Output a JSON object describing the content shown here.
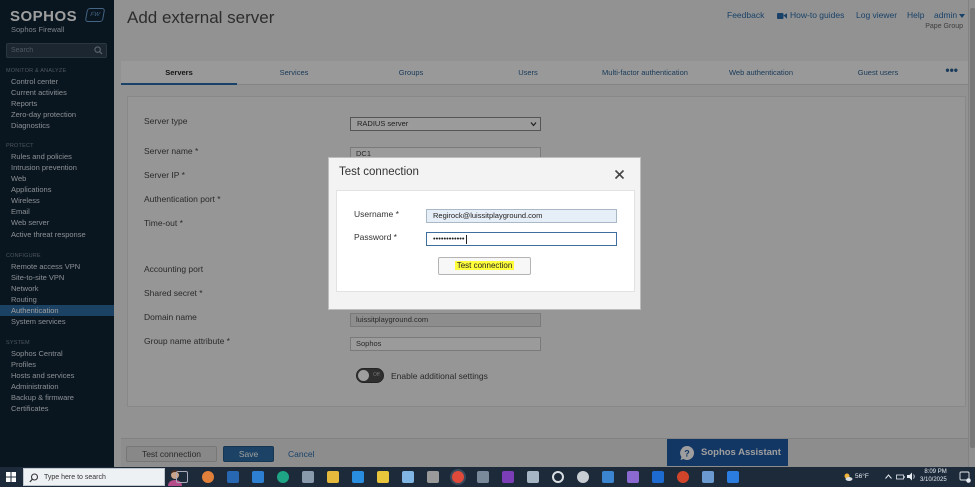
{
  "brand": {
    "logo": "SOPHOS",
    "badge": "FW",
    "product": "Sophos Firewall"
  },
  "sidebar": {
    "search_placeholder": "Search",
    "sections": [
      {
        "title": "MONITOR & ANALYZE",
        "items": [
          "Control center",
          "Current activities",
          "Reports",
          "Zero-day protection",
          "Diagnostics"
        ]
      },
      {
        "title": "PROTECT",
        "items": [
          "Rules and policies",
          "Intrusion prevention",
          "Web",
          "Applications",
          "Wireless",
          "Email",
          "Web server",
          "Active threat response"
        ]
      },
      {
        "title": "CONFIGURE",
        "items": [
          "Remote access VPN",
          "Site-to-site VPN",
          "Network",
          "Routing",
          "Authentication",
          "System services"
        ]
      },
      {
        "title": "SYSTEM",
        "items": [
          "Sophos Central",
          "Profiles",
          "Hosts and services",
          "Administration",
          "Backup & firmware",
          "Certificates"
        ]
      }
    ],
    "active_item": "Authentication"
  },
  "header": {
    "title": "Add external server",
    "links": [
      "Feedback",
      "How-to guides",
      "Log viewer",
      "Help",
      "admin"
    ],
    "group": "Pape Group"
  },
  "tabs": [
    "Servers",
    "Services",
    "Groups",
    "Users",
    "Multi-factor authentication",
    "Web authentication",
    "Guest users"
  ],
  "active_tab": "Servers",
  "form": {
    "server_type_label": "Server type",
    "server_type_value": "RADIUS server",
    "server_name_label": "Server name *",
    "server_name_value": "DC1",
    "server_ip_label": "Server IP *",
    "auth_port_label": "Authentication port *",
    "timeout_label": "Time-out *",
    "accounting_port_label": "Accounting port",
    "shared_secret_label": "Shared secret *",
    "domain_name_label": "Domain name",
    "domain_name_value": "luissitplayground.com",
    "group_attr_label": "Group name attribute *",
    "group_attr_value": "Sophos",
    "toggle_state": "Off",
    "additional_settings_label": "Enable additional settings"
  },
  "footer": {
    "test_label": "Test connection",
    "save_label": "Save",
    "cancel_label": "Cancel",
    "assistant_label": "Sophos Assistant"
  },
  "modal": {
    "title": "Test connection",
    "username_label": "Username *",
    "username_value": "Regirock@luissitplayground.com",
    "password_label": "Password *",
    "password_value": "••••••••••••",
    "button_label": "Test connection"
  },
  "taskbar": {
    "search_placeholder": "Type here to search",
    "weather": "56°F",
    "time": "8:09 PM",
    "date": "3/10/2025"
  },
  "colors": {
    "sidebar": "#0f2233",
    "accent": "#2e6da4",
    "active_nav": "#2c6aa0",
    "highlight": "#ffff3c"
  }
}
